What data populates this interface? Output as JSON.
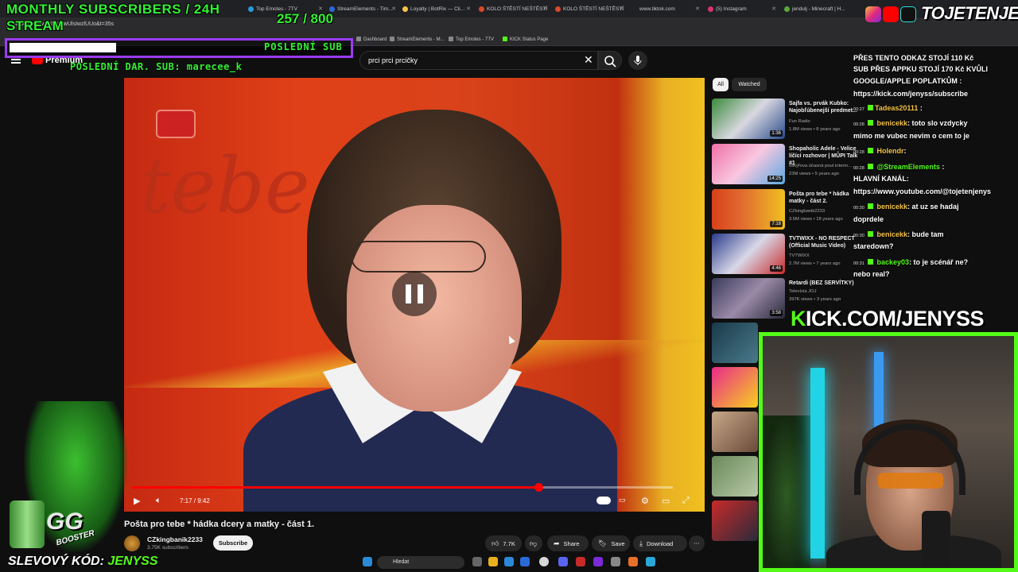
{
  "browser": {
    "tabs": [
      "Top Emotes - 7TV",
      "StreamElements - Tim...",
      "Loyalty | BotRix — Cli...",
      "KOLO ŠTĚSTÍ NEŠTĚSTÍ",
      "KOLO ŠTĚSTÍ NEŠTĚSTÍ",
      "www.tiktok.com",
      "(5) Instagram",
      "jendulj - Minecraft | H..."
    ],
    "url": "youtube.com/watch?v=wUlsIwzlUUo&t=35s",
    "bookmarks": [
      "Dashboard",
      "StreamElements - M...",
      "Top Emotes - 7TV",
      "KICK Status Page"
    ]
  },
  "overlay": {
    "monthly_subs_label": "MONTHLY SUBSCRIBERS / 24H",
    "stream_label": "STREAM",
    "sub_counter": "257 / 800",
    "last_sub_label": "POSLEDNÍ SUB",
    "last_donation": "POSLEDNÍ DAR. SUB: marecee_k",
    "promo_code": "SLEVOVÝ KÓD: ",
    "promo_code_value": "JENYSS",
    "brand": "TOJETENJENYS",
    "kick_url_prefix": "K",
    "kick_url": "ICK.COM/JENYSS",
    "booster_logo": "GG",
    "booster_text": "BOOSTER"
  },
  "youtube": {
    "premium_label": "Premium",
    "search_query": "prci prci prcičky",
    "player": {
      "time": "7:17 / 9:42",
      "progress": 0.7515
    },
    "video_title": "Pošta pro tebe * hádka dcery a matky - část 1.",
    "channel_name": "CZkingbanik2233",
    "channel_subs": "3.75K subscribers",
    "subscribe_label": "Subscribe",
    "likes": "7.7K",
    "share_label": "Share",
    "save_label": "Save",
    "download_label": "Download",
    "filters": [
      "All",
      "Watched"
    ],
    "recommendations": [
      {
        "title": "Sajfa vs. prvák Kubko: Najobľúbenejší predmet...",
        "channel": "Fun Radio",
        "meta": "1.8M views • 8 years ago",
        "duration": "1:36"
      },
      {
        "title": "Shopaholic Adele - Velice líčící rozhovor | MŮPI Talk #1",
        "channel": "Mikýřova účasná pout interm...",
        "meta": "23M views • 5 years ago",
        "duration": "14:25"
      },
      {
        "title": "Pošta pro tebe * hádka matky - část 2.",
        "channel": "CZkingbanik2233",
        "meta": "3.5M views • 18 years ago",
        "duration": "7:18"
      },
      {
        "title": "TVTWIXX - NO RESPECT (Official Music Video)",
        "channel": "TVTWIXX",
        "meta": "2.7M views • 7 years ago",
        "duration": "4:46"
      },
      {
        "title": "Retardi (BEZ SERVÍTKY)",
        "channel": "Televízia JOJ",
        "meta": "397K views • 3 years ago",
        "duration": "3:58"
      }
    ]
  },
  "chat": {
    "pinned": [
      "PŘES TENTO ODKAZ STOJÍ 110 Kč",
      "SUB PŘES APPKU STOJÍ 170 Kč KVŮLI",
      "GOOGLE/APPLE POPLATKŮM :",
      "https://kick.com/jenyss/subscribe"
    ],
    "messages": [
      {
        "time": "00:27",
        "user": "Tadeas20111",
        "text": ""
      },
      {
        "time": "00:28",
        "user": "benicekk",
        "text": ": toto slo vzdycky"
      },
      {
        "time": "",
        "user": "",
        "text": "mimo me vubec nevim o cem to je"
      },
      {
        "time": "00:28",
        "user": "Holendr",
        "text": ":"
      },
      {
        "time": "00:28",
        "user": "@StreamElements",
        "text": ":"
      },
      {
        "time": "",
        "user": "",
        "text": "HLAVNÍ KANÁL:"
      },
      {
        "time": "",
        "user": "",
        "text": "https://www.youtube.com/@tojetenjenys"
      },
      {
        "time": "00:30",
        "user": "benicekk",
        "text": ": at uz se hadaj"
      },
      {
        "time": "",
        "user": "",
        "text": "doprdele"
      },
      {
        "time": "00:30",
        "user": "benicekk",
        "text": ": bude tam"
      },
      {
        "time": "",
        "user": "",
        "text": "staredown?"
      },
      {
        "time": "00:31",
        "user": "backey03",
        "text": ": to je scénář ne?"
      },
      {
        "time": "",
        "user": "",
        "text": "nebo real?"
      }
    ]
  },
  "taskbar": {
    "search_placeholder": "Hledat"
  },
  "colors": {
    "kick_green": "#53fc18",
    "overlay_green": "#34f033",
    "overlay_purple": "#9b3cf4",
    "youtube_red": "#ff0000"
  }
}
